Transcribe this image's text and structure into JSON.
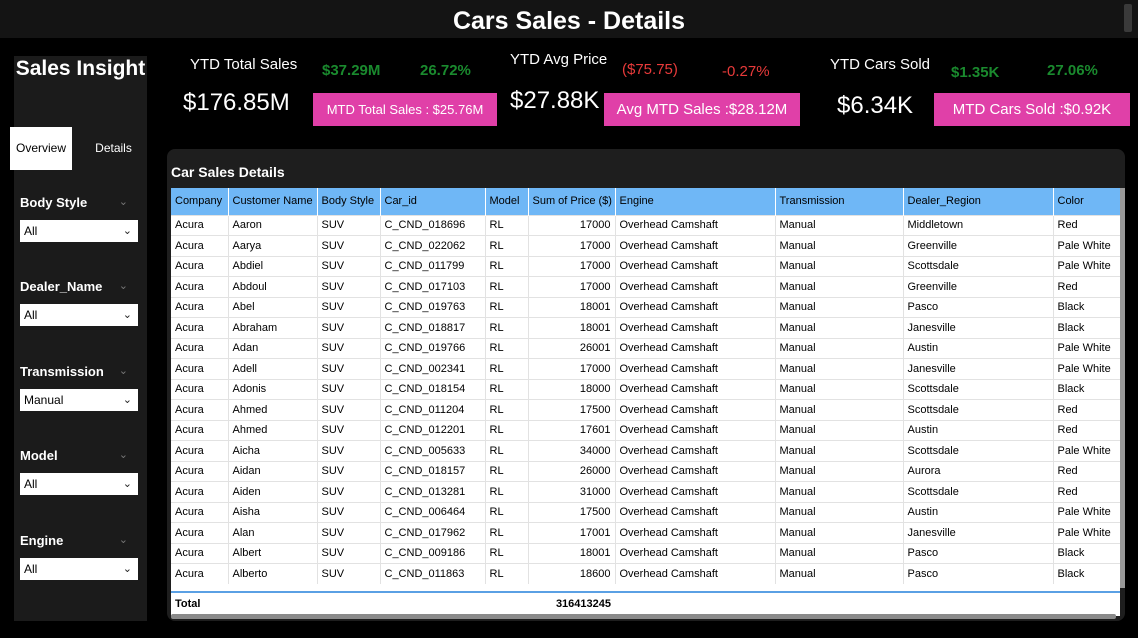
{
  "header": {
    "title": "Cars Sales - Details"
  },
  "sidebar": {
    "brand": "Sales Insight",
    "tabs": [
      {
        "label": "Overview",
        "active": true
      },
      {
        "label": "Details",
        "active": false
      }
    ],
    "slicers": [
      {
        "label": "Body Style",
        "value": "All"
      },
      {
        "label": "Dealer_Name",
        "value": "All"
      },
      {
        "label": "Transmission",
        "value": "Manual"
      },
      {
        "label": "Model",
        "value": "All"
      },
      {
        "label": "Engine",
        "value": "All"
      }
    ]
  },
  "kpis": {
    "total_sales": {
      "label": "YTD Total Sales",
      "value": "$176.85M",
      "delta": "$37.29M",
      "pct": "26.72%",
      "mtd": "MTD Total Sales : $25.76M"
    },
    "avg_price": {
      "label": "YTD Avg Price",
      "value": "$27.88K",
      "delta": "($75.75)",
      "pct": "-0.27%",
      "mtd": "Avg MTD Sales :$28.12M"
    },
    "cars_sold": {
      "label": "YTD Cars Sold",
      "value": "$6.34K",
      "delta": "$1.35K",
      "pct": "27.06%",
      "mtd": "MTD Cars Sold :$0.92K"
    }
  },
  "table": {
    "title": "Car Sales Details",
    "columns": [
      "Company",
      "Customer Name",
      "Body Style",
      "Car_id",
      "Model",
      "Sum of Price ($)",
      "Engine",
      "Transmission",
      "Dealer_Region",
      "Color"
    ],
    "rows": [
      [
        "Acura",
        "Aaron",
        "SUV",
        "C_CND_018696",
        "RL",
        "17000",
        "Overhead Camshaft",
        "Manual",
        "Middletown",
        "Red"
      ],
      [
        "Acura",
        "Aarya",
        "SUV",
        "C_CND_022062",
        "RL",
        "17000",
        "Overhead Camshaft",
        "Manual",
        "Greenville",
        "Pale White"
      ],
      [
        "Acura",
        "Abdiel",
        "SUV",
        "C_CND_011799",
        "RL",
        "17000",
        "Overhead Camshaft",
        "Manual",
        "Scottsdale",
        "Pale White"
      ],
      [
        "Acura",
        "Abdoul",
        "SUV",
        "C_CND_017103",
        "RL",
        "17000",
        "Overhead Camshaft",
        "Manual",
        "Greenville",
        "Red"
      ],
      [
        "Acura",
        "Abel",
        "SUV",
        "C_CND_019763",
        "RL",
        "18001",
        "Overhead Camshaft",
        "Manual",
        "Pasco",
        "Black"
      ],
      [
        "Acura",
        "Abraham",
        "SUV",
        "C_CND_018817",
        "RL",
        "18001",
        "Overhead Camshaft",
        "Manual",
        "Janesville",
        "Black"
      ],
      [
        "Acura",
        "Adan",
        "SUV",
        "C_CND_019766",
        "RL",
        "26001",
        "Overhead Camshaft",
        "Manual",
        "Austin",
        "Pale White"
      ],
      [
        "Acura",
        "Adell",
        "SUV",
        "C_CND_002341",
        "RL",
        "17000",
        "Overhead Camshaft",
        "Manual",
        "Janesville",
        "Pale White"
      ],
      [
        "Acura",
        "Adonis",
        "SUV",
        "C_CND_018154",
        "RL",
        "18000",
        "Overhead Camshaft",
        "Manual",
        "Scottsdale",
        "Black"
      ],
      [
        "Acura",
        "Ahmed",
        "SUV",
        "C_CND_011204",
        "RL",
        "17500",
        "Overhead Camshaft",
        "Manual",
        "Scottsdale",
        "Red"
      ],
      [
        "Acura",
        "Ahmed",
        "SUV",
        "C_CND_012201",
        "RL",
        "17601",
        "Overhead Camshaft",
        "Manual",
        "Austin",
        "Red"
      ],
      [
        "Acura",
        "Aicha",
        "SUV",
        "C_CND_005633",
        "RL",
        "34000",
        "Overhead Camshaft",
        "Manual",
        "Scottsdale",
        "Pale White"
      ],
      [
        "Acura",
        "Aidan",
        "SUV",
        "C_CND_018157",
        "RL",
        "26000",
        "Overhead Camshaft",
        "Manual",
        "Aurora",
        "Red"
      ],
      [
        "Acura",
        "Aiden",
        "SUV",
        "C_CND_013281",
        "RL",
        "31000",
        "Overhead Camshaft",
        "Manual",
        "Scottsdale",
        "Red"
      ],
      [
        "Acura",
        "Aisha",
        "SUV",
        "C_CND_006464",
        "RL",
        "17500",
        "Overhead Camshaft",
        "Manual",
        "Austin",
        "Pale White"
      ],
      [
        "Acura",
        "Alan",
        "SUV",
        "C_CND_017962",
        "RL",
        "17001",
        "Overhead Camshaft",
        "Manual",
        "Janesville",
        "Pale White"
      ],
      [
        "Acura",
        "Albert",
        "SUV",
        "C_CND_009186",
        "RL",
        "18001",
        "Overhead Camshaft",
        "Manual",
        "Pasco",
        "Black"
      ],
      [
        "Acura",
        "Alberto",
        "SUV",
        "C_CND_011863",
        "RL",
        "18600",
        "Overhead Camshaft",
        "Manual",
        "Pasco",
        "Black"
      ]
    ],
    "total_label": "Total",
    "total_value": "316413245"
  },
  "colors": {
    "accent": "#e040a8",
    "header": "#6fb7f6",
    "positive": "#1a8a2e",
    "negative": "#e83a3a"
  }
}
